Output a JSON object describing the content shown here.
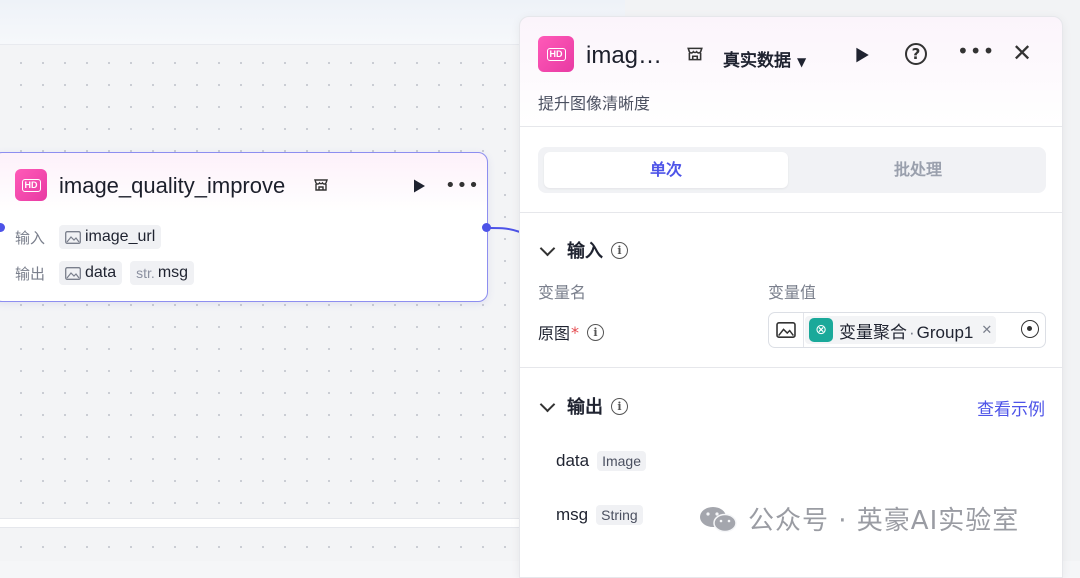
{
  "node": {
    "title": "image_quality_improve",
    "icon_label": "HD",
    "input_label": "输入",
    "output_label": "输出",
    "inputs": [
      {
        "name": "image_url",
        "type_icon": "image-icon"
      }
    ],
    "outputs": [
      {
        "name": "data",
        "type_icon": "image-icon"
      },
      {
        "name": "msg",
        "type_prefix": "str."
      }
    ]
  },
  "panel": {
    "title": "imag…",
    "icon_label": "HD",
    "realdata_label": "真实数据",
    "description": "提升图像清晰度",
    "tabs": [
      "单次",
      "批处理"
    ],
    "active_tab": 0,
    "input_section": {
      "title": "输入",
      "col_name": "变量名",
      "col_value": "变量值",
      "param_name": "原图",
      "param_required": "*",
      "value_tag": "变量聚合",
      "value_group": "Group1",
      "value_separator": "·"
    },
    "output_section": {
      "title": "输出",
      "link": "查看示例",
      "rows": [
        {
          "name": "data",
          "type": "Image"
        },
        {
          "name": "msg",
          "type": "String"
        }
      ]
    }
  },
  "watermark": {
    "text": "公众号 · 英豪AI实验室"
  },
  "colors": {
    "accent": "#4d53e8",
    "brand_pink": "#ff5ab8",
    "teal": "#1aa99a",
    "required": "#e5484d"
  }
}
